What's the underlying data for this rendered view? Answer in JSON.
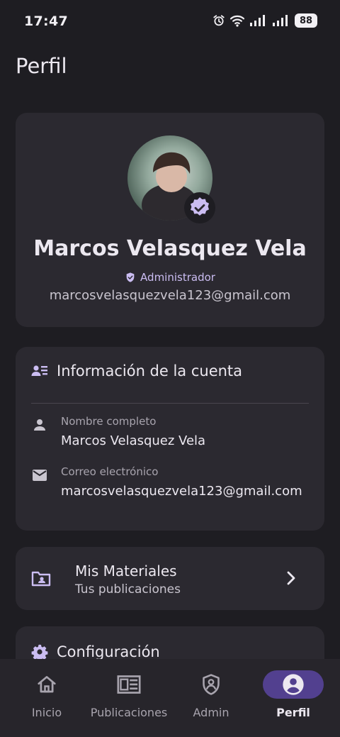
{
  "status": {
    "time": "17:47",
    "battery": "88"
  },
  "page": {
    "title": "Perfil"
  },
  "profile": {
    "name": "Marcos Velasquez Vela",
    "role": "Administrador",
    "email": "marcosvelasquezvela123@gmail.com"
  },
  "account_info": {
    "title": "Información de la cuenta",
    "fields": [
      {
        "label": "Nombre completo",
        "value": "Marcos Velasquez Vela",
        "icon": "person-icon"
      },
      {
        "label": "Correo electrónico",
        "value": "marcosvelasquezvela123@gmail.com",
        "icon": "mail-icon"
      }
    ]
  },
  "materials": {
    "title": "Mis Materiales",
    "subtitle": "Tus publicaciones"
  },
  "config": {
    "title": "Configuración"
  },
  "nav": {
    "items": [
      {
        "label": "Inicio",
        "icon": "home-icon"
      },
      {
        "label": "Publicaciones",
        "icon": "publications-icon"
      },
      {
        "label": "Admin",
        "icon": "admin-shield-icon"
      },
      {
        "label": "Perfil",
        "icon": "profile-icon"
      }
    ],
    "active": "Perfil"
  },
  "colors": {
    "background": "#1e1d22",
    "card": "#2b2930",
    "accent": "#cbbdf2",
    "active_pill": "#52408f"
  }
}
